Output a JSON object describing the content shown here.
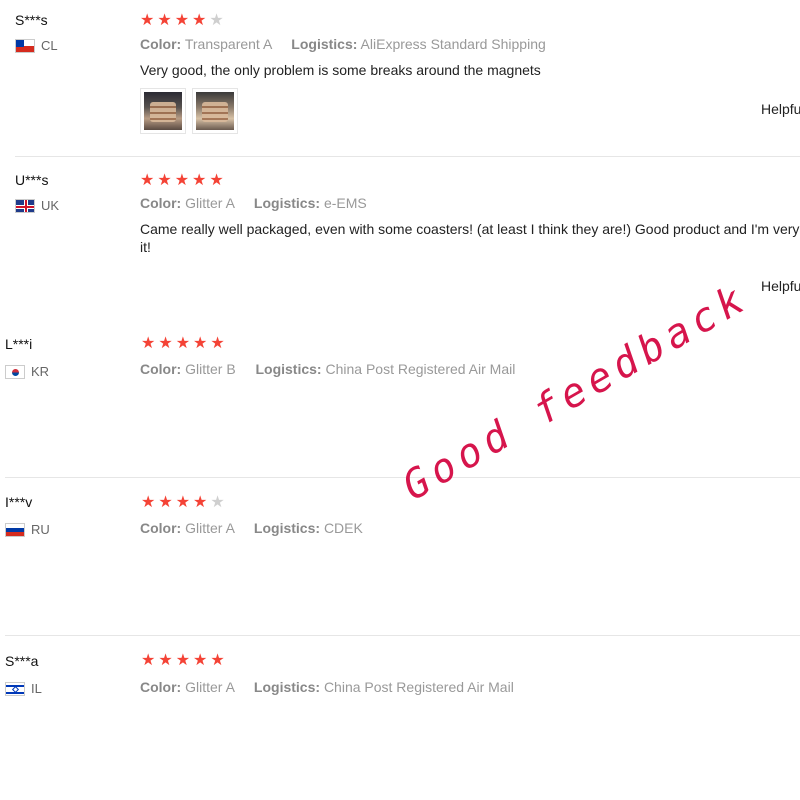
{
  "reviews": [
    {
      "user": "S***s",
      "country": "CL",
      "rating": 4,
      "color_label": "Color:",
      "color_value": "Transparent A",
      "logistics_label": "Logistics:",
      "logistics_value": "AliExpress Standard Shipping",
      "text": "Very good, the only problem is some breaks around the magnets",
      "helpful": "Helpfu"
    },
    {
      "user": "U***s",
      "country": "UK",
      "rating": 5,
      "color_label": "Color:",
      "color_value": "Glitter A",
      "logistics_label": "Logistics:",
      "logistics_value": "e-EMS",
      "text_line1": "Came really well packaged, even with some coasters! (at least I think they are!) Good product and I'm very happ",
      "text_line2": "it!",
      "helpful": "Helpfu"
    },
    {
      "user": "L***i",
      "country": "KR",
      "rating": 5,
      "color_label": "Color:",
      "color_value": "Glitter B",
      "logistics_label": "Logistics:",
      "logistics_value": "China Post Registered Air Mail"
    },
    {
      "user": "I***v",
      "country": "RU",
      "rating": 4,
      "color_label": "Color:",
      "color_value": "Glitter A",
      "logistics_label": "Logistics:",
      "logistics_value": "CDEK"
    },
    {
      "user": "S***a",
      "country": "IL",
      "rating": 5,
      "color_label": "Color:",
      "color_value": "Glitter A",
      "logistics_label": "Logistics:",
      "logistics_value": "China Post Registered Air Mail"
    }
  ],
  "watermark": "Good feedback",
  "colors": {
    "star_on": "#f44336",
    "star_off": "#cfcfcf",
    "watermark": "#d6154c"
  }
}
